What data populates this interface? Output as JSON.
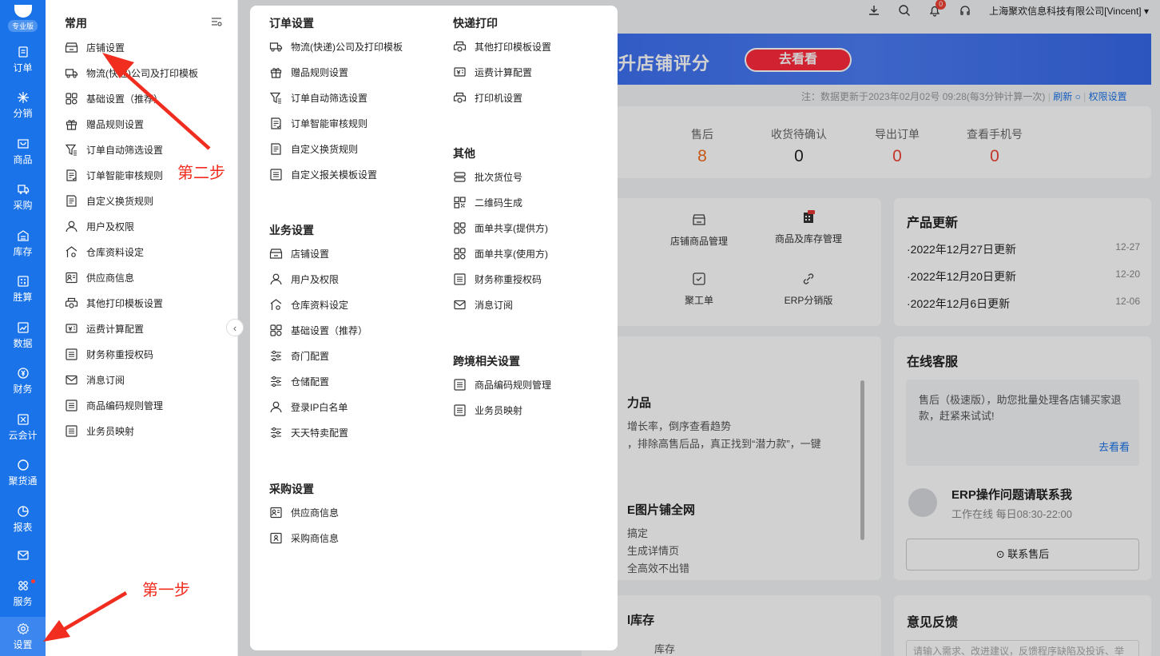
{
  "brand": {
    "edition": "专业版"
  },
  "leftnav": [
    {
      "label": "订单",
      "icon": "order-icon"
    },
    {
      "label": "分销",
      "icon": "distribution-icon"
    },
    {
      "label": "商品",
      "icon": "goods-icon"
    },
    {
      "label": "采购",
      "icon": "purchase-icon"
    },
    {
      "label": "库存",
      "icon": "inventory-icon"
    },
    {
      "label": "胜算",
      "icon": "calculator-icon"
    },
    {
      "label": "数据",
      "icon": "data-icon"
    },
    {
      "label": "财务",
      "icon": "finance-icon"
    },
    {
      "label": "云会计",
      "icon": "accounting-icon"
    },
    {
      "label": "聚货通",
      "icon": "circle-icon"
    },
    {
      "label": "报表",
      "icon": "report-icon"
    },
    {
      "label": "",
      "icon": "mail-icon"
    },
    {
      "label": "服务",
      "icon": "service-icon"
    },
    {
      "label": "设置",
      "icon": "gear-icon"
    }
  ],
  "topbar": {
    "company": "上海聚欢信息科技有限公司[Vincent]",
    "notify_count": "0"
  },
  "banner": {
    "text": "你提升店铺评分",
    "button": "去看看"
  },
  "notice": {
    "prefix": "注：数据更新于2023年02月02号 09:28(每3分钟计算一次)",
    "refresh": "刷新",
    "permission": "权限设置"
  },
  "stats": [
    {
      "label": "售后",
      "value": "8",
      "color": "#f26b1d"
    },
    {
      "label": "收货待确认",
      "value": "0",
      "color": "#222222"
    },
    {
      "label": "导出订单",
      "value": "0",
      "color": "#f04134"
    },
    {
      "label": "查看手机号",
      "value": "0",
      "color": "#f04134"
    }
  ],
  "tools": [
    {
      "label": "店铺商品管理",
      "icon": "store-icon"
    },
    {
      "label": "商品及库存管理",
      "icon": "stock-calendar-icon"
    },
    {
      "label": "聚工单",
      "icon": "ticket-icon"
    },
    {
      "label": "ERP分销版",
      "icon": "link-icon"
    }
  ],
  "updates": {
    "title": "产品更新",
    "rows": [
      {
        "text": "·2022年12月27日更新",
        "date": "12-27"
      },
      {
        "text": "·2022年12月20日更新",
        "date": "12-20"
      },
      {
        "text": "·2022年12月6日更新",
        "date": "12-06"
      }
    ]
  },
  "service": {
    "title": "在线客服",
    "tip": "售后（极速版），助您批量处理各店铺买家退款，赶紧来试试!",
    "tip_link": "去看看",
    "agent_title": "ERP操作问题请联系我",
    "agent_hours": "工作在线 每日08:30-22:00",
    "contact": "联系售后"
  },
  "feed_partial": {
    "title": "力品",
    "line1": "增长率，倒序查看趋势",
    "line2": "，排除高售后品，真正找到“潜力款”，一键",
    "title2": "E图片铺全网",
    "line3": "搞定",
    "line4": "生成详情页",
    "line5": "全高效不出错"
  },
  "inventory_partial": {
    "title": "l库存",
    "col": "库存"
  },
  "feedback": {
    "title": "意见反馈",
    "placeholder": "请输入需求、改进建议，反馈程序缺陷及投诉、举"
  },
  "common": {
    "title": "常用",
    "items": [
      {
        "label": "店铺设置",
        "icon": "store-icon"
      },
      {
        "label": "物流(快递)公司及打印模板",
        "icon": "truck-icon"
      },
      {
        "label": "基础设置（推荐）",
        "icon": "grid-icon"
      },
      {
        "label": "赠品规则设置",
        "icon": "gift-icon"
      },
      {
        "label": "订单自动筛选设置",
        "icon": "filter-icon"
      },
      {
        "label": "订单智能审核规则",
        "icon": "doc-check-icon"
      },
      {
        "label": "自定义换货规则",
        "icon": "doc-icon"
      },
      {
        "label": "用户及权限",
        "icon": "user-icon"
      },
      {
        "label": "仓库资料设定",
        "icon": "warehouse-icon"
      },
      {
        "label": "供应商信息",
        "icon": "supplier-icon"
      },
      {
        "label": "其他打印模板设置",
        "icon": "printer-icon"
      },
      {
        "label": "运费计算配置",
        "icon": "freight-icon"
      },
      {
        "label": "财务称重授权码",
        "icon": "list-icon"
      },
      {
        "label": "消息订阅",
        "icon": "mail-icon"
      },
      {
        "label": "商品编码规则管理",
        "icon": "list-icon"
      },
      {
        "label": "业务员映射",
        "icon": "list-icon"
      }
    ]
  },
  "sections": {
    "order": {
      "title": "订单设置",
      "items": [
        {
          "label": "物流(快递)公司及打印模板",
          "icon": "truck-icon"
        },
        {
          "label": "赠品规则设置",
          "icon": "gift-icon"
        },
        {
          "label": "订单自动筛选设置",
          "icon": "filter-icon"
        },
        {
          "label": "订单智能审核规则",
          "icon": "doc-check-icon"
        },
        {
          "label": "自定义换货规则",
          "icon": "doc-icon"
        },
        {
          "label": "自定义报关模板设置",
          "icon": "list-icon"
        }
      ]
    },
    "business": {
      "title": "业务设置",
      "items": [
        {
          "label": "店铺设置",
          "icon": "store-icon"
        },
        {
          "label": "用户及权限",
          "icon": "user-icon"
        },
        {
          "label": "仓库资料设定",
          "icon": "warehouse-icon"
        },
        {
          "label": "基础设置（推荐）",
          "icon": "grid-icon"
        },
        {
          "label": "奇门配置",
          "icon": "sliders-icon"
        },
        {
          "label": "仓储配置",
          "icon": "sliders-icon"
        },
        {
          "label": "登录IP白名单",
          "icon": "user-icon"
        },
        {
          "label": "天天特卖配置",
          "icon": "sliders-icon"
        }
      ]
    },
    "purchase": {
      "title": "采购设置",
      "items": [
        {
          "label": "供应商信息",
          "icon": "supplier-icon"
        },
        {
          "label": "采购商信息",
          "icon": "buyer-icon"
        }
      ]
    },
    "express": {
      "title": "快递打印",
      "items": [
        {
          "label": "其他打印模板设置",
          "icon": "printer-icon"
        },
        {
          "label": "运费计算配置",
          "icon": "freight-icon"
        },
        {
          "label": "打印机设置",
          "icon": "printer-icon"
        }
      ]
    },
    "other": {
      "title": "其他",
      "items": [
        {
          "label": "批次货位号",
          "icon": "batch-icon"
        },
        {
          "label": "二维码生成",
          "icon": "qrcode-icon"
        },
        {
          "label": "面单共享(提供方)",
          "icon": "grid-icon"
        },
        {
          "label": "面单共享(使用方)",
          "icon": "grid-icon"
        },
        {
          "label": "财务称重授权码",
          "icon": "list-icon"
        },
        {
          "label": "消息订阅",
          "icon": "mail-icon"
        }
      ]
    },
    "crossborder": {
      "title": "跨境相关设置",
      "items": [
        {
          "label": "商品编码规则管理",
          "icon": "list-icon"
        },
        {
          "label": "业务员映射",
          "icon": "list-icon"
        }
      ]
    }
  },
  "annotations": {
    "step1": "第一步",
    "step2": "第二步"
  }
}
